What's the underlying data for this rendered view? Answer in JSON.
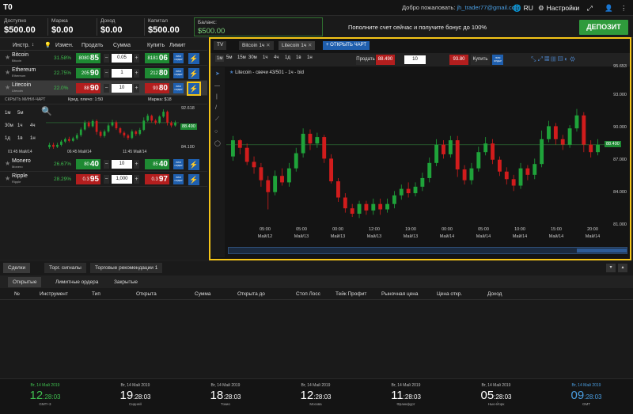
{
  "app": {
    "logo": "T0",
    "welcome_prefix": "Добро пожаловать:",
    "user": "jh_trader77@gmail.com",
    "lang": "RU",
    "settings": "Настройки"
  },
  "account": {
    "available_label": "Доступно",
    "available": "$500.00",
    "margin_label": "Маржа",
    "margin": "$0.00",
    "profit_label": "Доход",
    "profit": "$0.00",
    "capital_label": "Капитал",
    "capital": "$500.00",
    "balance_label": "Баланс:",
    "balance": "$500.00",
    "promo": "Пополните счет сейчас и получите бонус до 100%",
    "deposit": "ДЕПОЗИТ"
  },
  "watchlist": {
    "headers": {
      "instr": "Инстр.",
      "change": "Измен.",
      "sell": "Продать",
      "amount": "Сумма",
      "buy": "Купить",
      "limit": "Лимит"
    },
    "rows": [
      {
        "name": "Bitcoin",
        "sub": "Bitcoin",
        "change": "31.58%",
        "sell_small": "8080",
        "sell_big": "85",
        "amount": "0.05",
        "buy_small": "8181",
        "buy_big": "06",
        "lim": "ЛИМ ОРДЕР",
        "change_color": "#3fbf4f"
      },
      {
        "name": "Ethereum",
        "sub": "Ethereum",
        "change": "22.75%",
        "sell_small": "205",
        "sell_big": "90",
        "amount": "1",
        "buy_small": "212",
        "buy_big": "80",
        "lim": "ЛИМ ОРДЕР",
        "change_color": "#3fbf4f"
      },
      {
        "name": "Litecoin",
        "sub": "Litecoin",
        "change": "22.0%",
        "sell_small": "88",
        "sell_big": "90",
        "amount": "10",
        "buy_small": "93",
        "buy_big": "80",
        "lim": "ЛИМ ОРДЕР",
        "change_color": "#3fbf4f"
      },
      {
        "name": "Monero",
        "sub": "Monero",
        "change": "26.67%",
        "sell_small": "80",
        "sell_big": "40",
        "amount": "10",
        "buy_small": "85",
        "buy_big": "40",
        "lim": "ЛИМ ОРДЕР",
        "change_color": "#3fbf4f"
      },
      {
        "name": "Ripple",
        "sub": "Ripple",
        "change": "28.29%",
        "sell_small": "0.3",
        "sell_big": "95",
        "amount": "1,000",
        "buy_small": "0.3",
        "buy_big": "97",
        "lim": "ЛИМ ОРДЕР",
        "change_color": "#3fbf4f"
      }
    ],
    "hide_mini": "СКРЫТЬ МИНИ-ЧАРТ",
    "leverage": "Кред. плечо: 1:50",
    "margin": "Маржа: $18",
    "mini": {
      "tf": [
        "1м",
        "5м",
        "30м",
        "1ч",
        "4ч",
        "1д",
        "1в",
        "1н"
      ],
      "ymax": "92.618",
      "ymid": "88.490",
      "ymin": "84.100",
      "x": [
        "01:45 Май/14",
        "06:45 Май/14",
        "11:45 Май/14"
      ]
    }
  },
  "chart": {
    "tabs": [
      "TV",
      "Bitcoin 1ч",
      "Litecoin 1ч"
    ],
    "open_chart": "+ ОТКРЫТЬ ЧАРТ",
    "timeframes": [
      "1м",
      "5м",
      "15м",
      "30м",
      "1ч",
      "4ч",
      "1д",
      "1в",
      "1н"
    ],
    "sell": "Продать",
    "sell_price": "88.490",
    "amount": "10",
    "buy_price": "93.80",
    "buy": "Купить",
    "lim": "ЛИМ ОРДЕР",
    "title": "Litecoin - свечи 43/501 - 1ч - bid",
    "current": "88.490",
    "y_ticks": [
      "95.653",
      "93.000",
      "90.000",
      "87.000",
      "84.000",
      "81.000"
    ],
    "x_ticks": [
      [
        "05:00",
        "Май/12"
      ],
      [
        "05:00",
        "Май/13"
      ],
      [
        "00:00",
        "Май/13"
      ],
      [
        "12:00",
        "Май/13"
      ],
      [
        "19:00",
        "Май/13"
      ],
      [
        "00:00",
        "Май/14"
      ],
      [
        "05:00",
        "Май/14"
      ],
      [
        "10:00",
        "Май/14"
      ],
      [
        "15:00",
        "Май/14"
      ],
      [
        "20:00",
        "Май/14"
      ]
    ]
  },
  "chart_data": {
    "type": "candlestick",
    "title": "Litecoin - свечи 43/501 - 1ч - bid",
    "ylim": [
      81,
      95.653
    ],
    "candles": [
      [
        87.4,
        88.9,
        89.3,
        87.0
      ],
      [
        88.9,
        88.2,
        89.0,
        87.6
      ],
      [
        88.2,
        86.9,
        88.6,
        86.6
      ],
      [
        86.9,
        86.4,
        87.4,
        85.8
      ],
      [
        86.4,
        85.2,
        86.8,
        84.6
      ],
      [
        85.2,
        84.1,
        85.6,
        82.5
      ],
      [
        84.1,
        85.6,
        86.1,
        83.8
      ],
      [
        85.6,
        85.0,
        86.3,
        84.7
      ],
      [
        85.0,
        86.3,
        86.8,
        84.6
      ],
      [
        86.3,
        87.7,
        88.2,
        86.0
      ],
      [
        87.7,
        89.5,
        90.0,
        87.3
      ],
      [
        89.5,
        88.6,
        89.9,
        88.0
      ],
      [
        88.6,
        89.2,
        89.6,
        88.2
      ],
      [
        89.2,
        87.2,
        89.4,
        86.8
      ],
      [
        87.2,
        85.1,
        87.6,
        84.9
      ],
      [
        85.1,
        83.6,
        85.4,
        83.2
      ],
      [
        83.6,
        82.6,
        84.0,
        82.2
      ],
      [
        82.6,
        82.1,
        83.0,
        81.8
      ],
      [
        82.1,
        83.0,
        83.3,
        81.7
      ],
      [
        83.0,
        82.4,
        83.3,
        82.0
      ],
      [
        82.4,
        83.0,
        83.5,
        82.0
      ],
      [
        83.0,
        82.5,
        83.5,
        82.0
      ],
      [
        82.5,
        83.0,
        83.5,
        82.2
      ],
      [
        83.0,
        83.8,
        84.2,
        82.6
      ],
      [
        83.8,
        84.4,
        84.8,
        83.4
      ],
      [
        84.4,
        84.0,
        85.0,
        83.6
      ],
      [
        84.0,
        84.6,
        85.0,
        83.7
      ],
      [
        84.6,
        85.4,
        85.9,
        84.2
      ],
      [
        85.4,
        86.8,
        87.3,
        85.0
      ],
      [
        86.8,
        88.5,
        89.0,
        86.5
      ],
      [
        88.5,
        87.6,
        88.9,
        87.2
      ],
      [
        87.6,
        88.9,
        89.3,
        87.3
      ],
      [
        88.9,
        86.2,
        89.3,
        85.5
      ],
      [
        86.2,
        85.2,
        86.6,
        84.8
      ],
      [
        85.2,
        86.3,
        86.8,
        84.8
      ],
      [
        86.3,
        87.8,
        88.3,
        86.0
      ],
      [
        87.8,
        88.6,
        89.2,
        87.5
      ],
      [
        88.6,
        87.1,
        89.0,
        86.7
      ],
      [
        87.1,
        86.0,
        87.4,
        85.6
      ],
      [
        86.0,
        85.3,
        86.4,
        84.8
      ],
      [
        85.3,
        84.7,
        85.7,
        84.2
      ],
      [
        84.7,
        86.3,
        86.8,
        84.4
      ],
      [
        86.3,
        85.7,
        86.6,
        85.2
      ],
      [
        85.7,
        86.7,
        87.2,
        85.3
      ],
      [
        86.7,
        89.0,
        89.8,
        86.4
      ],
      [
        89.0,
        90.2,
        90.7,
        88.7
      ],
      [
        90.2,
        89.0,
        90.5,
        88.5
      ],
      [
        89.0,
        88.5,
        89.4,
        88.0
      ],
      [
        88.5,
        90.0,
        90.3,
        88.2
      ],
      [
        90.0,
        91.2,
        91.8,
        89.7
      ],
      [
        91.2,
        88.5,
        91.5,
        87.8
      ],
      [
        88.5,
        87.8,
        88.9,
        87.3
      ],
      [
        87.8,
        88.5,
        89.0,
        87.5
      ]
    ]
  },
  "bottom": {
    "tabs": [
      "Сделки",
      "Торг. сигналы",
      "Торговые рекомендации 1"
    ],
    "subtabs": [
      "Открытые",
      "Лимитные ордера",
      "Закрытые"
    ],
    "columns": [
      "№",
      "Инструмент",
      "Тип",
      "Открыта",
      "Сумма",
      "Открыта до",
      "Стоп Лосс",
      "Тейк Профит",
      "Рыночная цена",
      "Цена откр.",
      "Доход"
    ]
  },
  "clocks": [
    {
      "date": "Вт, 14 Май 2019",
      "h": "12",
      "m": ":28:03",
      "city": "GMT+3"
    },
    {
      "date": "Вт, 14 Май 2019",
      "h": "19",
      "m": ":28:03",
      "city": "Сидней"
    },
    {
      "date": "Вт, 14 Май 2019",
      "h": "18",
      "m": ":28:03",
      "city": "Токио"
    },
    {
      "date": "Вт, 14 Май 2019",
      "h": "12",
      "m": ":28:03",
      "city": "Москва"
    },
    {
      "date": "Вт, 14 Май 2019",
      "h": "11",
      "m": ":28:03",
      "city": "Франкфурт"
    },
    {
      "date": "Вт, 14 Май 2019",
      "h": "05",
      "m": ":28:03",
      "city": "Нью-Йорк"
    },
    {
      "date": "Вт, 14 Май 2019",
      "h": "09",
      "m": ":28:03",
      "city": "GMT"
    }
  ]
}
